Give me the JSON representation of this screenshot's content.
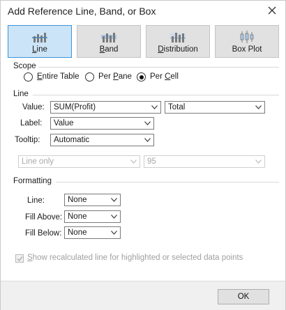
{
  "window": {
    "title": "Add Reference Line, Band, or Box"
  },
  "tabs": [
    {
      "label": "Line",
      "mnemonic": "L",
      "rest": "ine",
      "active": true,
      "icon": "reference-line-icon"
    },
    {
      "label": "Band",
      "mnemonic": "B",
      "rest": "and",
      "active": false,
      "icon": "reference-band-icon"
    },
    {
      "label": "Distribution",
      "mnemonic": "D",
      "rest": "istribution",
      "active": false,
      "icon": "distribution-icon"
    },
    {
      "label": "Box Plot",
      "mnemonic": "",
      "rest": "Box Plot",
      "active": false,
      "icon": "box-plot-icon"
    }
  ],
  "scope": {
    "heading": "Scope",
    "options": [
      {
        "label": "Entire Table",
        "pre": "",
        "mnemonic": "E",
        "post": "ntire Table",
        "selected": false
      },
      {
        "label": "Per Pane",
        "pre": "Per ",
        "mnemonic": "P",
        "post": "ane",
        "selected": false
      },
      {
        "label": "Per Cell",
        "pre": "Per ",
        "mnemonic": "C",
        "post": "ell",
        "selected": true
      }
    ]
  },
  "line": {
    "heading": "Line",
    "value_label": "Value:",
    "value": "SUM(Profit)",
    "aggregation": "Total",
    "label_label": "Label:",
    "label_value": "Value",
    "tooltip_label": "Tooltip:",
    "tooltip_value": "Automatic",
    "ci_select": "Line only",
    "ci_value": "95"
  },
  "formatting": {
    "heading": "Formatting",
    "line_label": "Line:",
    "line_value": "None",
    "fill_above_label": "Fill Above:",
    "fill_above_value": "None",
    "fill_below_label": "Fill Below:",
    "fill_below_value": "None"
  },
  "recalc": {
    "checked": true,
    "enabled": false,
    "mnemonic": "S",
    "rest": "how recalculated line for highlighted or selected data points",
    "label": "Show recalculated line for highlighted or selected data points"
  },
  "footer": {
    "ok_label": "OK"
  },
  "colors": {
    "active_tab_bg": "#cce4f7",
    "active_tab_border": "#3c94d8",
    "icon_blue": "#4a7fb0"
  }
}
